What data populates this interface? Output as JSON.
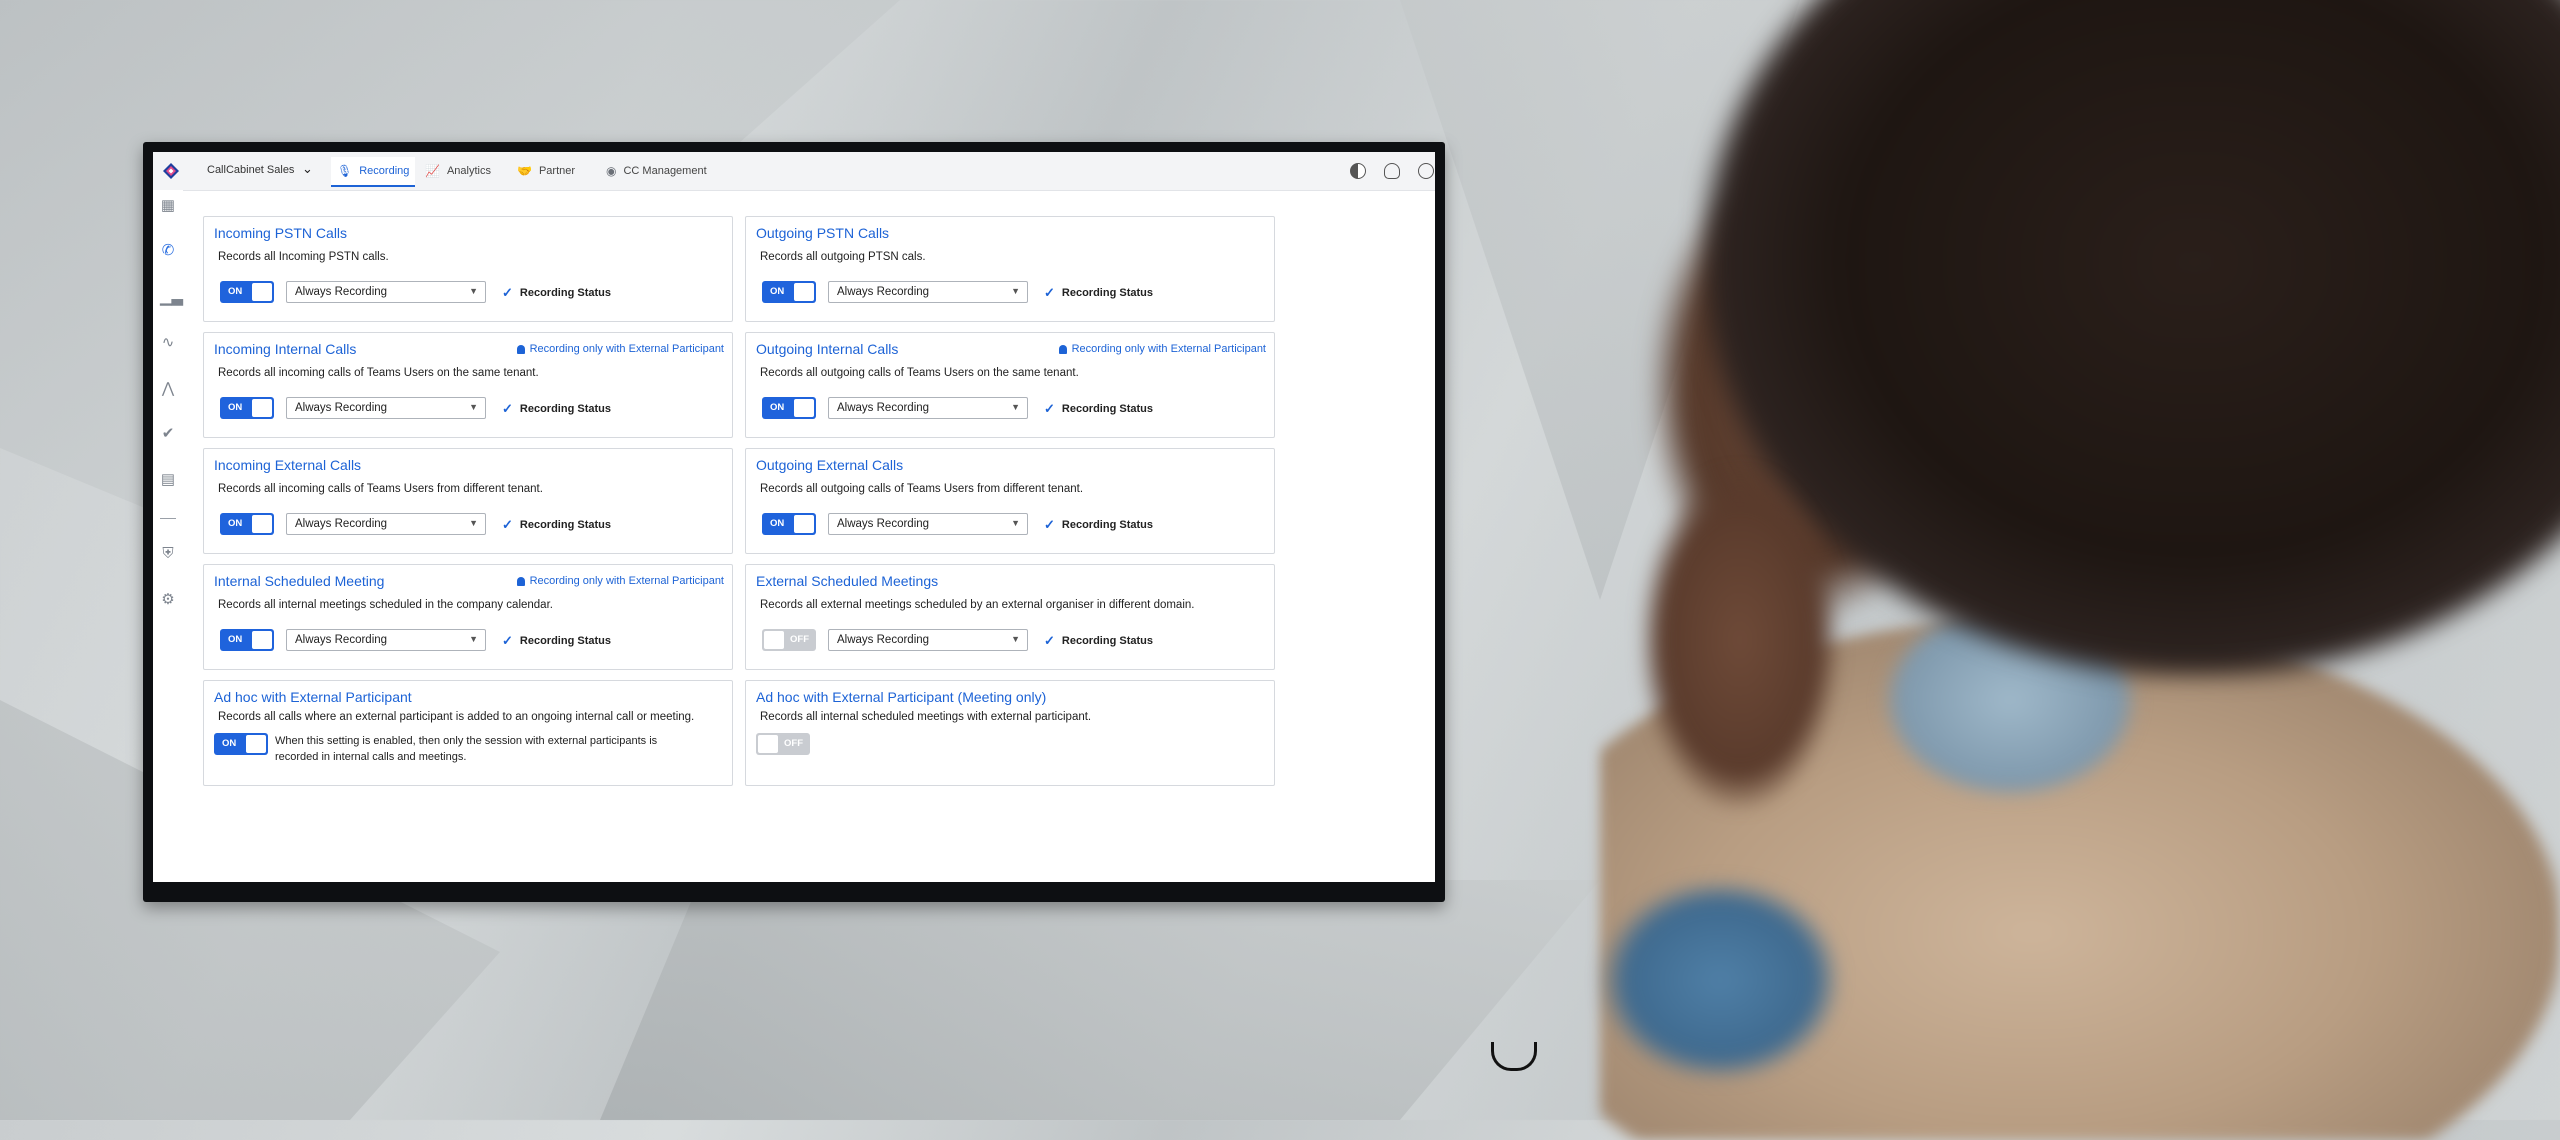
{
  "topbar": {
    "tenant": "CallCabinet Sales",
    "tabs": [
      {
        "label": "Recording",
        "icon": "microphone-icon"
      },
      {
        "label": "Analytics",
        "icon": "chart-image-icon"
      },
      {
        "label": "Partner",
        "icon": "handshake-icon"
      },
      {
        "label": "CC Management",
        "icon": "cc-management-icon"
      }
    ],
    "right_icons": [
      "contrast-icon",
      "headset-icon",
      "user-circle-icon"
    ]
  },
  "rail": {
    "icons": [
      "dashboard-icon",
      "phone-icon",
      "bar-chart-icon",
      "trend-icon",
      "waveform-icon",
      "check-circle-icon",
      "calendar-icon",
      "shield-icon",
      "gear-icon"
    ],
    "active": "phone-icon"
  },
  "cards": [
    {
      "title": "Incoming PSTN Calls",
      "desc": "Records all Incoming PSTN calls.",
      "toggle": "ON",
      "select": "Always Recording",
      "status": "Recording Status"
    },
    {
      "title": "Outgoing PSTN Calls",
      "desc": "Records all outgoing PTSN cals.",
      "toggle": "ON",
      "select": "Always Recording",
      "status": "Recording Status"
    },
    {
      "title": "Incoming Internal Calls",
      "badge": "Recording only with External Participant",
      "desc": "Records all incoming calls of Teams Users on the same tenant.",
      "toggle": "ON",
      "select": "Always Recording",
      "status": "Recording Status"
    },
    {
      "title": "Outgoing Internal Calls",
      "badge": "Recording only with External Participant",
      "desc": "Records all outgoing calls of Teams Users on the same tenant.",
      "toggle": "ON",
      "select": "Always Recording",
      "status": "Recording Status"
    },
    {
      "title": "Incoming External Calls",
      "desc": "Records all incoming calls of Teams Users from different tenant.",
      "toggle": "ON",
      "select": "Always Recording",
      "status": "Recording Status"
    },
    {
      "title": "Outgoing External Calls",
      "desc": "Records all outgoing calls of Teams Users from different tenant.",
      "toggle": "ON",
      "select": "Always Recording",
      "status": "Recording Status"
    },
    {
      "title": "Internal Scheduled Meeting",
      "badge": "Recording only with External Participant",
      "desc": "Records all internal meetings scheduled in the company calendar.",
      "toggle": "ON",
      "select": "Always Recording",
      "status": "Recording Status"
    },
    {
      "title": "External Scheduled Meetings",
      "desc": "Records all external meetings scheduled by an external organiser in different domain.",
      "toggle": "OFF",
      "select": "Always Recording",
      "status": "Recording Status"
    },
    {
      "title": "Ad hoc with External Participant",
      "desc": "Records all calls where an external participant is added to an ongoing internal call or meeting.",
      "toggle": "ON",
      "note": "When this setting is enabled, then only the session with external participants is recorded in internal calls and meetings."
    },
    {
      "title": "Ad hoc with External Participant (Meeting only)",
      "desc": "Records all internal scheduled meetings with external participant.",
      "toggle": "OFF"
    }
  ]
}
